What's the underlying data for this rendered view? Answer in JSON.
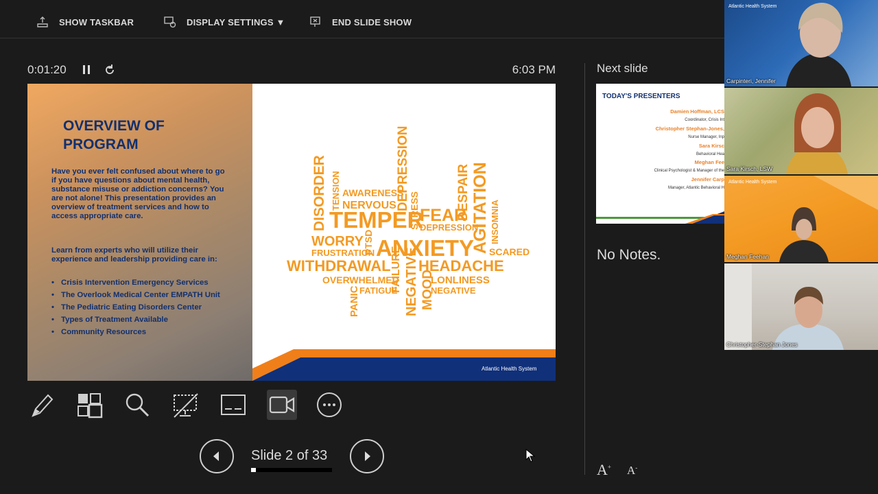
{
  "toolbar": {
    "show_taskbar": "SHOW TASKBAR",
    "display_settings": "DISPLAY SETTINGS ▼",
    "end_slide_show": "END SLIDE SHOW"
  },
  "presenter": {
    "timer": "0:01:20",
    "clock": "6:03 PM",
    "slide_counter": "Slide 2 of 33",
    "progress_fraction": 0.06,
    "next_slide_label": "Next slide",
    "notes": "No Notes."
  },
  "slide": {
    "title": "OVERVIEW OF PROGRAM",
    "paragraph1": "Have you ever felt confused about where to go if you have questions about mental health, substance misuse or addiction concerns? You are not alone! This presentation provides an overview of treatment services and how to access appropriate care.",
    "paragraph2": "Learn from experts who will utilize their experience and leadership providing care in:",
    "bullets": [
      "Crisis Intervention Emergency Services",
      "The Overlook Medical Center EMPATH Unit",
      "The Pediatric Eating Disorders Center",
      "Types of Treatment Available",
      "Community Resources"
    ],
    "footer_brand": "Atlantic Health System",
    "accent_orange": "#f39a23",
    "title_navy": "#12306e"
  },
  "next_slide": {
    "title": "TODAY'S PRESENTERS",
    "lines": [
      {
        "name": "Damien Hoffman, LCS",
        "role": "Coordinator, Crisis Int"
      },
      {
        "name": "Christopher Stephan-Jones,",
        "role": "Nurse Manager, Inp"
      },
      {
        "name": "Sara Kirsc",
        "role": "Behavioral Hea"
      },
      {
        "name": "Meghan Fee",
        "role": "Clinical Psychologist & Manager of the"
      },
      {
        "name": "Jennifer Carp",
        "role": "Manager, Atlantic Behavioral H"
      }
    ]
  },
  "participants": [
    {
      "name": "Carpinteri, Jennifer",
      "brand": "Atlantic Health System"
    },
    {
      "name": "Sara Kirsch, LSW",
      "brand": ""
    },
    {
      "name": "Meghan Feehan",
      "brand": "Atlantic Health System"
    },
    {
      "name": "Christopher-Stephan Jones",
      "brand": ""
    }
  ],
  "icons": [
    "upload-taskbar-icon",
    "display-settings-icon",
    "end-show-icon",
    "pause-icon",
    "reload-icon",
    "pen-icon",
    "slides-grid-icon",
    "zoom-icon",
    "black-screen-icon",
    "subtitles-icon",
    "camera-icon",
    "more-icon",
    "previous-icon",
    "next-icon",
    "increase-font-icon",
    "decrease-font-icon",
    "mouse-cursor-icon"
  ]
}
